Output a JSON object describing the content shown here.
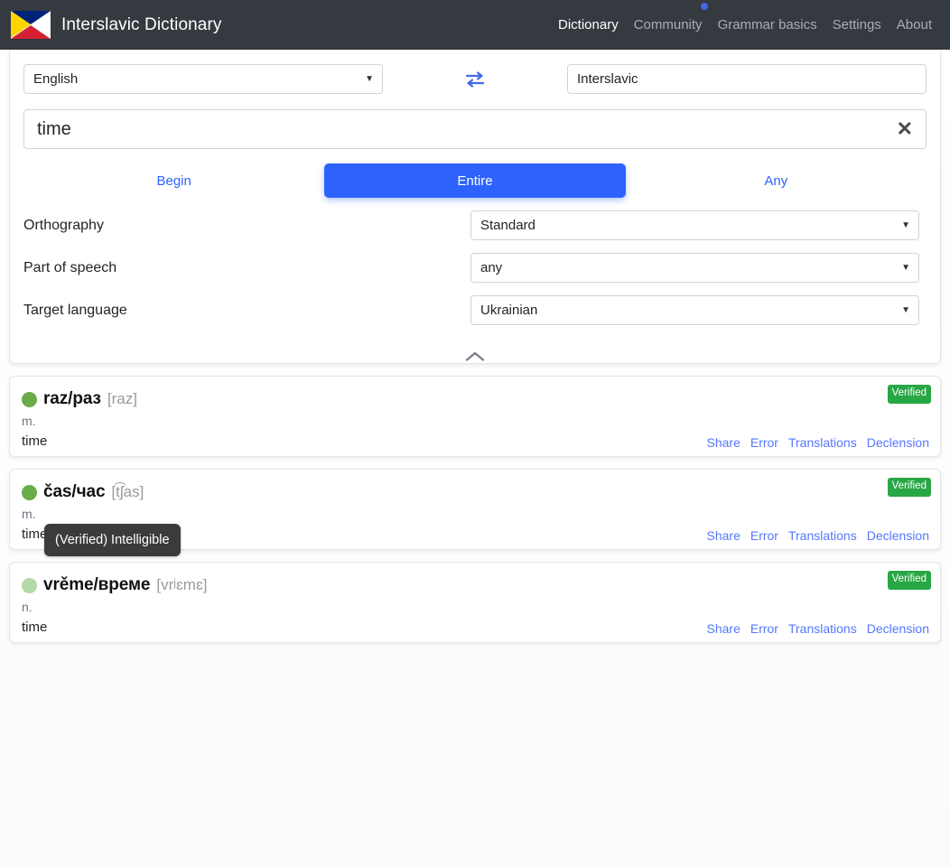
{
  "header": {
    "logo_icon": "interslavic-flag-icon",
    "title": "Interslavic Dictionary",
    "nav": [
      {
        "label": "Dictionary",
        "active": true
      },
      {
        "label": "Community",
        "active": false
      },
      {
        "label": "Grammar basics",
        "active": false
      },
      {
        "label": "Settings",
        "active": false
      },
      {
        "label": "About",
        "active": false
      }
    ],
    "notification_dot": "blue-dot-indicator",
    "colors": {
      "bar": "#343a40",
      "active_link": "#ffffff",
      "link": "#a9aeb4",
      "dot": "#4169e8"
    }
  },
  "search_panel": {
    "source_language": "English",
    "swap_icon": "swap-arrows-icon",
    "target_language": "Interslavic",
    "query": "time",
    "query_placeholder": "",
    "clear_icon": "close-x-icon",
    "modes": [
      {
        "label": "Begin",
        "active": false
      },
      {
        "label": "Entire",
        "active": true
      },
      {
        "label": "Any",
        "active": false
      }
    ],
    "options": [
      {
        "label": "Orthography",
        "value": "Standard"
      },
      {
        "label": "Part of speech",
        "value": "any"
      },
      {
        "label": "Target language",
        "value": "Ukrainian"
      }
    ],
    "collapse_icon": "chevron-up-icon",
    "accent_color": "#2d63fc"
  },
  "results": [
    {
      "status_dot": "#6aab4a",
      "headword": "raz/раз",
      "ipa": "[raz]",
      "gender": "m.",
      "definition": "time",
      "badge": "Verified",
      "links": [
        "Share",
        "Error",
        "Translations",
        "Declension"
      ]
    },
    {
      "status_dot": "#6aab4a",
      "headword": "čas/час",
      "ipa": "[t͡ʃas]",
      "gender": "m.",
      "definition": "time",
      "badge": "Verified",
      "links": [
        "Share",
        "Error",
        "Translations",
        "Declension"
      ]
    },
    {
      "status_dot": "#b5d8a8",
      "headword": "vrěme/време",
      "ipa": "[vrʲɛmɛ]",
      "gender": "n.",
      "definition": "time",
      "badge": "Verified",
      "links": [
        "Share",
        "Error",
        "Translations",
        "Declension"
      ]
    }
  ],
  "tooltip": {
    "text": "(Verified) Intelligible",
    "background": "#3b3b3b"
  }
}
